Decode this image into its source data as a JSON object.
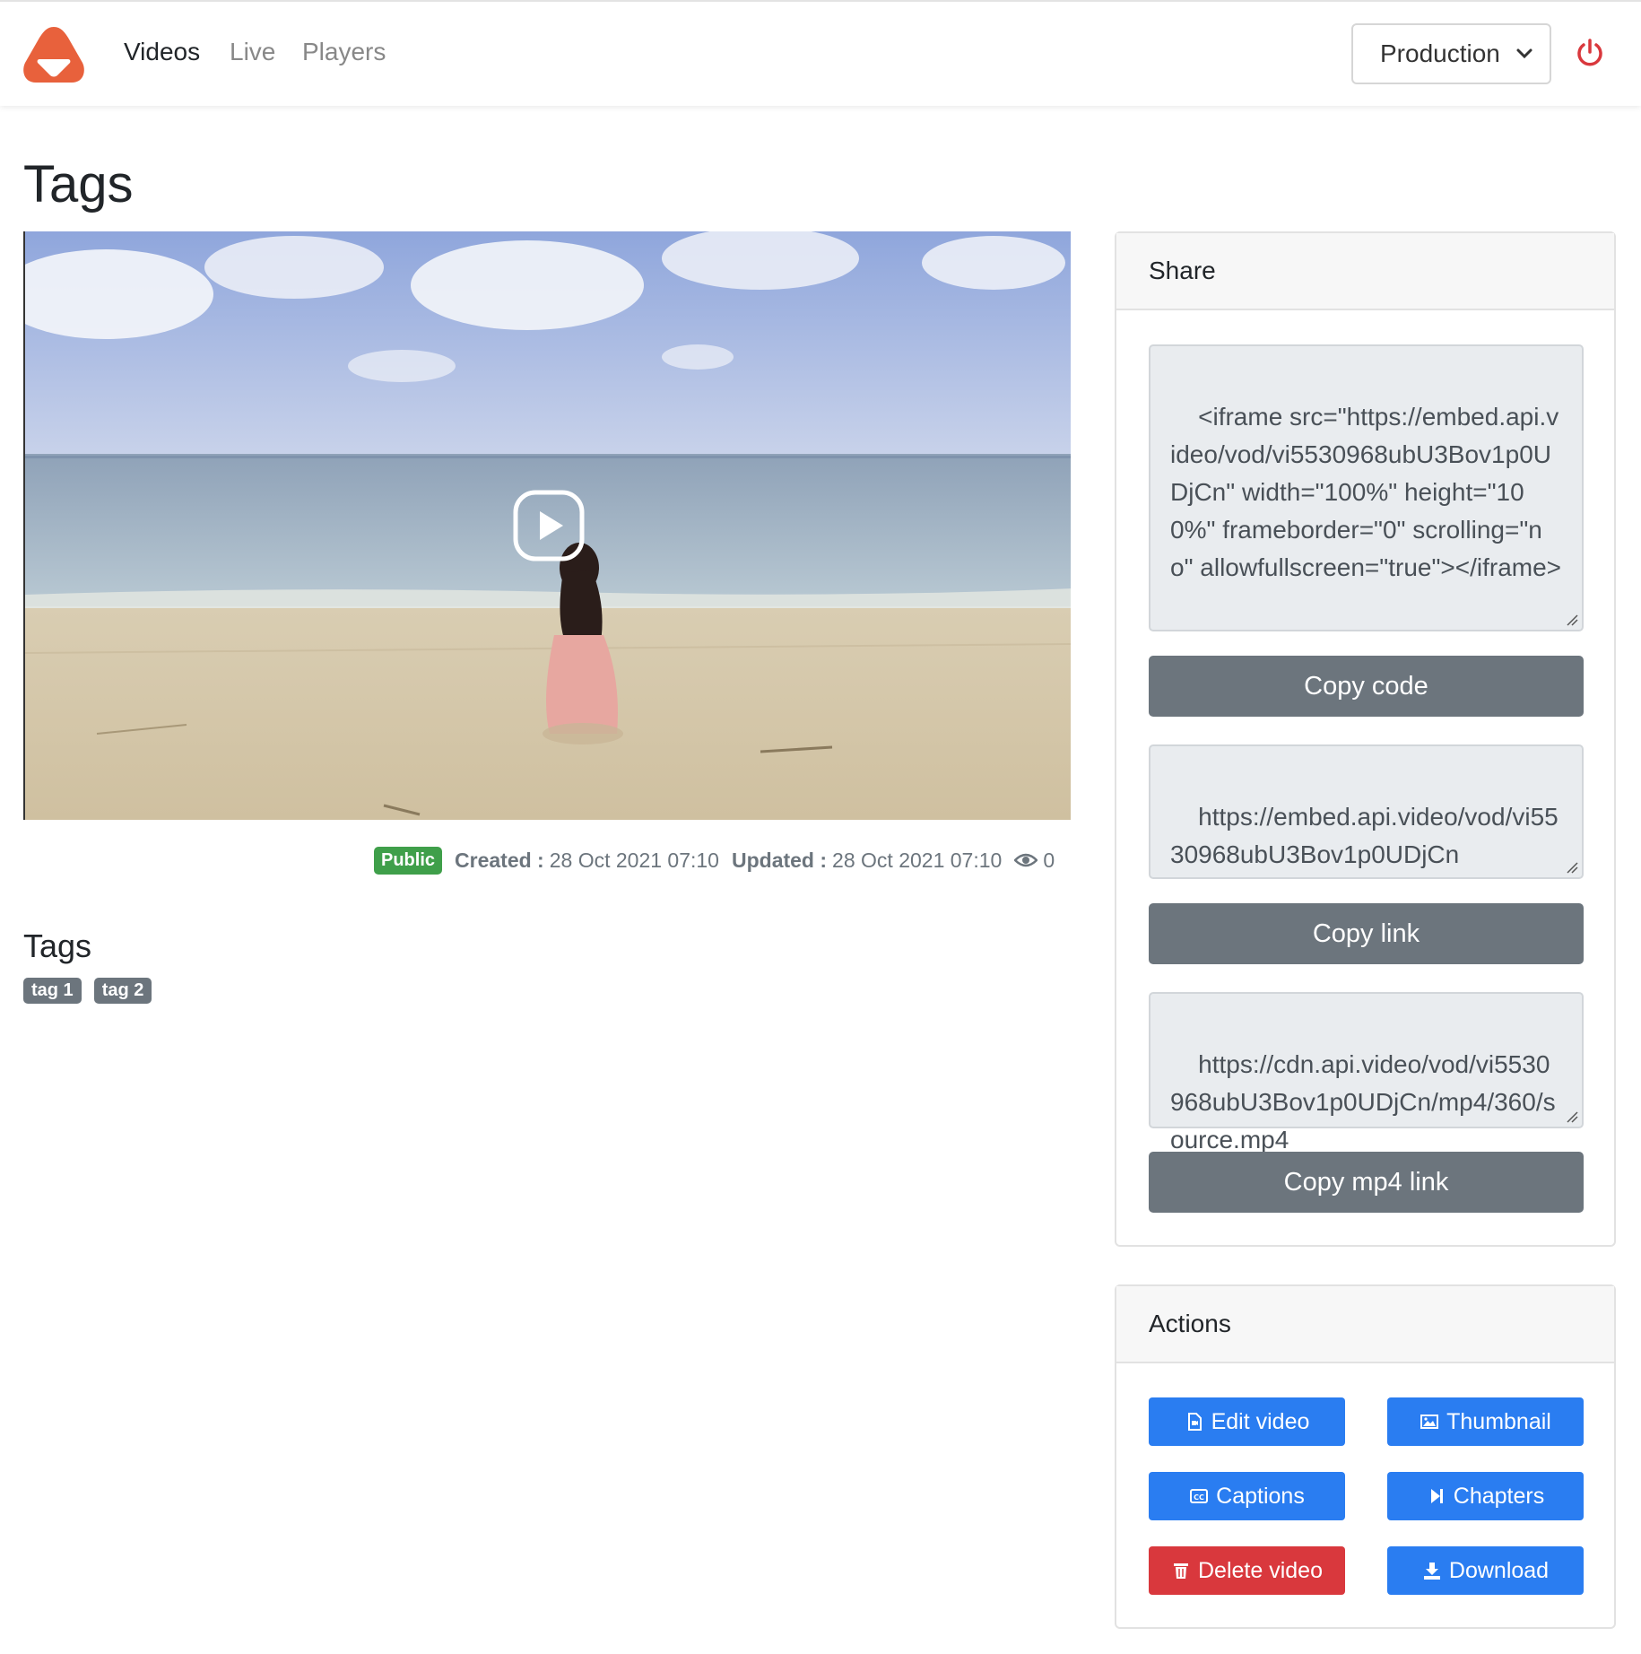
{
  "nav": {
    "links": [
      "Videos",
      "Live",
      "Players"
    ],
    "active": "Videos",
    "environment": "Production"
  },
  "page": {
    "title": "Tags"
  },
  "video": {
    "visibility": "Public",
    "created_label": "Created :",
    "created": "28 Oct 2021 07:10",
    "updated_label": "Updated :",
    "updated": "28 Oct 2021 07:10",
    "views": "0"
  },
  "tags_section": {
    "heading": "Tags",
    "tags": [
      "tag 1",
      "tag 2"
    ]
  },
  "share": {
    "title": "Share",
    "embed_code": "<iframe src=\"https://embed.api.video/vod/vi5530968ubU3Bov1p0UDjCn\" width=\"100%\" height=\"100%\" frameborder=\"0\" scrolling=\"no\" allowfullscreen=\"true\"></iframe>",
    "copy_code": "Copy code",
    "link": "https://embed.api.video/vod/vi5530968ubU3Bov1p0UDjCn",
    "copy_link": "Copy link",
    "mp4": "https://cdn.api.video/vod/vi5530968ubU3Bov1p0UDjCn/mp4/360/source.mp4",
    "copy_mp4": "Copy mp4 link"
  },
  "actions": {
    "title": "Actions",
    "edit": "Edit video",
    "thumbnail": "Thumbnail",
    "captions": "Captions",
    "chapters": "Chapters",
    "delete": "Delete video",
    "download": "Download"
  },
  "colors": {
    "brand": "#e8613c",
    "primary": "#2a7df1",
    "danger": "#d9383d",
    "secondary": "#6c757d",
    "success": "#3f9f4a"
  }
}
